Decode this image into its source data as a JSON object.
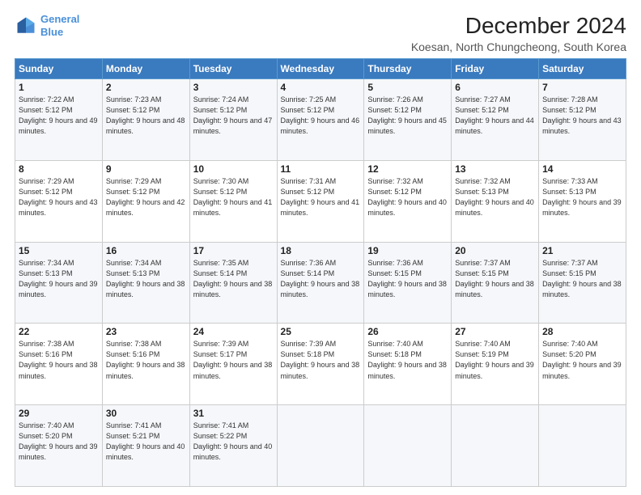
{
  "header": {
    "logo_line1": "General",
    "logo_line2": "Blue",
    "title": "December 2024",
    "subtitle": "Koesan, North Chungcheong, South Korea"
  },
  "weekdays": [
    "Sunday",
    "Monday",
    "Tuesday",
    "Wednesday",
    "Thursday",
    "Friday",
    "Saturday"
  ],
  "weeks": [
    [
      {
        "day": "1",
        "sunrise": "7:22 AM",
        "sunset": "5:12 PM",
        "daylight": "9 hours and 49 minutes."
      },
      {
        "day": "2",
        "sunrise": "7:23 AM",
        "sunset": "5:12 PM",
        "daylight": "9 hours and 48 minutes."
      },
      {
        "day": "3",
        "sunrise": "7:24 AM",
        "sunset": "5:12 PM",
        "daylight": "9 hours and 47 minutes."
      },
      {
        "day": "4",
        "sunrise": "7:25 AM",
        "sunset": "5:12 PM",
        "daylight": "9 hours and 46 minutes."
      },
      {
        "day": "5",
        "sunrise": "7:26 AM",
        "sunset": "5:12 PM",
        "daylight": "9 hours and 45 minutes."
      },
      {
        "day": "6",
        "sunrise": "7:27 AM",
        "sunset": "5:12 PM",
        "daylight": "9 hours and 44 minutes."
      },
      {
        "day": "7",
        "sunrise": "7:28 AM",
        "sunset": "5:12 PM",
        "daylight": "9 hours and 43 minutes."
      }
    ],
    [
      {
        "day": "8",
        "sunrise": "7:29 AM",
        "sunset": "5:12 PM",
        "daylight": "9 hours and 43 minutes."
      },
      {
        "day": "9",
        "sunrise": "7:29 AM",
        "sunset": "5:12 PM",
        "daylight": "9 hours and 42 minutes."
      },
      {
        "day": "10",
        "sunrise": "7:30 AM",
        "sunset": "5:12 PM",
        "daylight": "9 hours and 41 minutes."
      },
      {
        "day": "11",
        "sunrise": "7:31 AM",
        "sunset": "5:12 PM",
        "daylight": "9 hours and 41 minutes."
      },
      {
        "day": "12",
        "sunrise": "7:32 AM",
        "sunset": "5:12 PM",
        "daylight": "9 hours and 40 minutes."
      },
      {
        "day": "13",
        "sunrise": "7:32 AM",
        "sunset": "5:13 PM",
        "daylight": "9 hours and 40 minutes."
      },
      {
        "day": "14",
        "sunrise": "7:33 AM",
        "sunset": "5:13 PM",
        "daylight": "9 hours and 39 minutes."
      }
    ],
    [
      {
        "day": "15",
        "sunrise": "7:34 AM",
        "sunset": "5:13 PM",
        "daylight": "9 hours and 39 minutes."
      },
      {
        "day": "16",
        "sunrise": "7:34 AM",
        "sunset": "5:13 PM",
        "daylight": "9 hours and 38 minutes."
      },
      {
        "day": "17",
        "sunrise": "7:35 AM",
        "sunset": "5:14 PM",
        "daylight": "9 hours and 38 minutes."
      },
      {
        "day": "18",
        "sunrise": "7:36 AM",
        "sunset": "5:14 PM",
        "daylight": "9 hours and 38 minutes."
      },
      {
        "day": "19",
        "sunrise": "7:36 AM",
        "sunset": "5:15 PM",
        "daylight": "9 hours and 38 minutes."
      },
      {
        "day": "20",
        "sunrise": "7:37 AM",
        "sunset": "5:15 PM",
        "daylight": "9 hours and 38 minutes."
      },
      {
        "day": "21",
        "sunrise": "7:37 AM",
        "sunset": "5:15 PM",
        "daylight": "9 hours and 38 minutes."
      }
    ],
    [
      {
        "day": "22",
        "sunrise": "7:38 AM",
        "sunset": "5:16 PM",
        "daylight": "9 hours and 38 minutes."
      },
      {
        "day": "23",
        "sunrise": "7:38 AM",
        "sunset": "5:16 PM",
        "daylight": "9 hours and 38 minutes."
      },
      {
        "day": "24",
        "sunrise": "7:39 AM",
        "sunset": "5:17 PM",
        "daylight": "9 hours and 38 minutes."
      },
      {
        "day": "25",
        "sunrise": "7:39 AM",
        "sunset": "5:18 PM",
        "daylight": "9 hours and 38 minutes."
      },
      {
        "day": "26",
        "sunrise": "7:40 AM",
        "sunset": "5:18 PM",
        "daylight": "9 hours and 38 minutes."
      },
      {
        "day": "27",
        "sunrise": "7:40 AM",
        "sunset": "5:19 PM",
        "daylight": "9 hours and 39 minutes."
      },
      {
        "day": "28",
        "sunrise": "7:40 AM",
        "sunset": "5:20 PM",
        "daylight": "9 hours and 39 minutes."
      }
    ],
    [
      {
        "day": "29",
        "sunrise": "7:40 AM",
        "sunset": "5:20 PM",
        "daylight": "9 hours and 39 minutes."
      },
      {
        "day": "30",
        "sunrise": "7:41 AM",
        "sunset": "5:21 PM",
        "daylight": "9 hours and 40 minutes."
      },
      {
        "day": "31",
        "sunrise": "7:41 AM",
        "sunset": "5:22 PM",
        "daylight": "9 hours and 40 minutes."
      },
      null,
      null,
      null,
      null
    ]
  ]
}
